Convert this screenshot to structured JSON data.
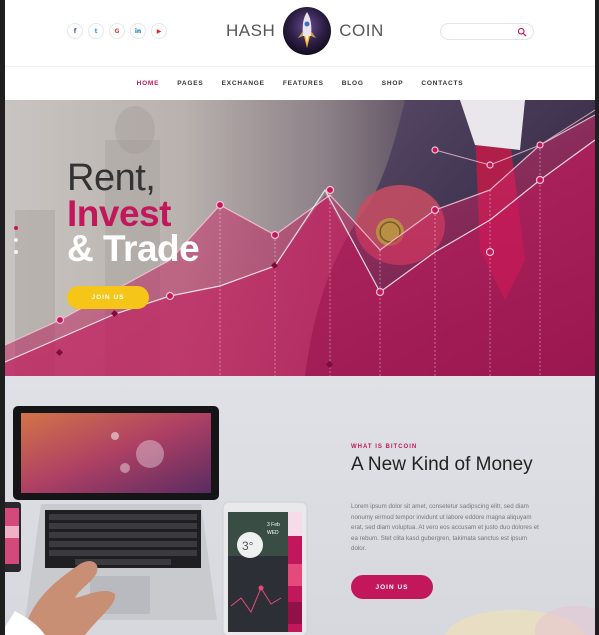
{
  "header": {
    "logo_left": "HASH",
    "logo_right": "COIN",
    "socials": [
      {
        "name": "facebook",
        "glyph": "f"
      },
      {
        "name": "twitter",
        "glyph": "t"
      },
      {
        "name": "google-plus",
        "glyph": "G"
      },
      {
        "name": "linkedin",
        "glyph": "in"
      },
      {
        "name": "youtube",
        "glyph": "▶"
      }
    ],
    "search": {
      "placeholder": "",
      "value": ""
    }
  },
  "nav": {
    "items": [
      "HOME",
      "PAGES",
      "EXCHANGE",
      "FEATURES",
      "BLOG",
      "SHOP",
      "CONTACTS"
    ],
    "active": "HOME"
  },
  "hero": {
    "line1": "Rent,",
    "line2": "Invest",
    "line3": "& Trade",
    "button": "JOIN US",
    "slides": 3,
    "active_slide": 1
  },
  "about": {
    "eyebrow": "WHAT IS BITCOIN",
    "title": "A New Kind of Money",
    "body": "Lorem ipsum dolor sit amet, consetetur sadipscing elitr, sed diam nonumy eirmod tempor invidunt ut labore eddore magna aliquyam erat, sed diam voluptua. At vero eos accusam et justo duo dolores et ea rebum. Stet clita kasd gubergren, takimata sanctus est ipsum dolor.",
    "button": "JOIN US",
    "tablet_date": "3 Feb",
    "tablet_day": "WED",
    "tablet_number": "3°"
  },
  "colors": {
    "accent": "#c2185b",
    "button_yellow": "#f5c518",
    "text_dark": "#333333"
  }
}
